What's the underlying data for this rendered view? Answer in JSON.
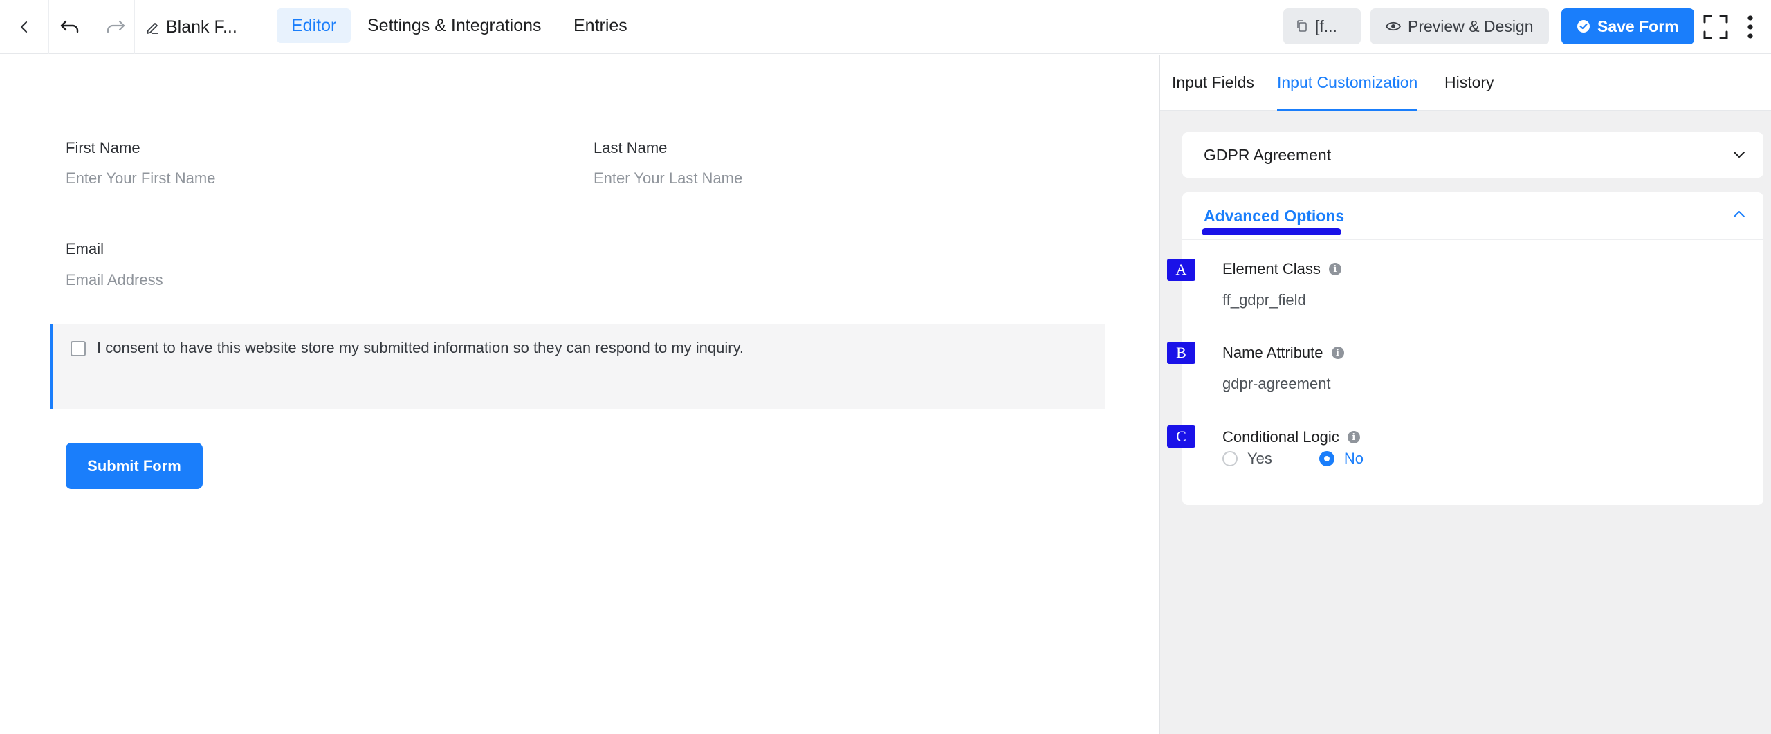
{
  "header": {
    "back_icon": "chevron-left-icon",
    "undo_icon": "undo-icon",
    "redo_icon": "redo-icon",
    "form_title": "Blank F...",
    "tabs": [
      {
        "label": "Editor",
        "active": true
      },
      {
        "label": "Settings & Integrations",
        "active": false
      },
      {
        "label": "Entries",
        "active": false
      }
    ],
    "shortcode_label": "[f...",
    "preview_label": "Preview & Design",
    "save_label": "Save Form",
    "accent_color": "#1a7efb"
  },
  "form": {
    "first_name": {
      "label": "First Name",
      "placeholder": "Enter Your First Name"
    },
    "last_name": {
      "label": "Last Name",
      "placeholder": "Enter Your Last Name"
    },
    "email": {
      "label": "Email",
      "placeholder": "Email Address"
    },
    "gdpr_text": "I consent to have this website store my submitted information so they can respond to my inquiry.",
    "submit_label": "Submit Form"
  },
  "panel": {
    "tabs": [
      {
        "label": "Input Fields",
        "active": false
      },
      {
        "label": "Input Customization",
        "active": true
      },
      {
        "label": "History",
        "active": false
      }
    ],
    "gdpr_section_title": "GDPR Agreement",
    "advanced": {
      "title": "Advanced Options",
      "element_class": {
        "marker": "A",
        "label": "Element Class",
        "value": "ff_gdpr_field"
      },
      "name_attribute": {
        "marker": "B",
        "label": "Name Attribute",
        "value": "gdpr-agreement"
      },
      "conditional_logic": {
        "marker": "C",
        "label": "Conditional Logic",
        "options": [
          "Yes",
          "No"
        ],
        "selected": "No"
      }
    }
  }
}
